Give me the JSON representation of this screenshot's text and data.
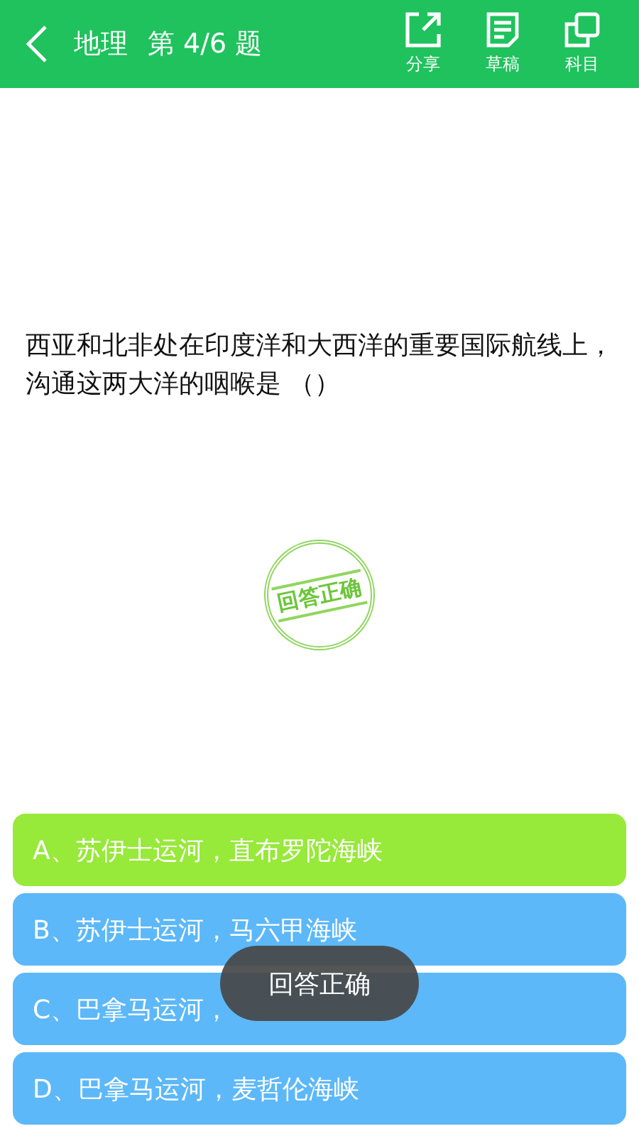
{
  "header": {
    "subject": "地理",
    "progress": "第 4/6 题",
    "actions": [
      {
        "kind": "share",
        "label": "分享"
      },
      {
        "kind": "draft",
        "label": "草稿"
      },
      {
        "kind": "subject",
        "label": "科目"
      }
    ]
  },
  "question": "西亚和北非处在印度洋和大西洋的重要国际航线上，沟通这两大洋的咽喉是 （）",
  "stamp": "回答正确",
  "options": [
    {
      "text": "A、苏伊士运河，直布罗陀海峡",
      "selected": true
    },
    {
      "text": "B、苏伊士运河，马六甲海峡",
      "selected": false
    },
    {
      "text": "C、巴拿马运河，",
      "selected": false
    },
    {
      "text": "D、巴拿马运河，麦哲伦海峡",
      "selected": false
    }
  ],
  "toast": "回答正确"
}
